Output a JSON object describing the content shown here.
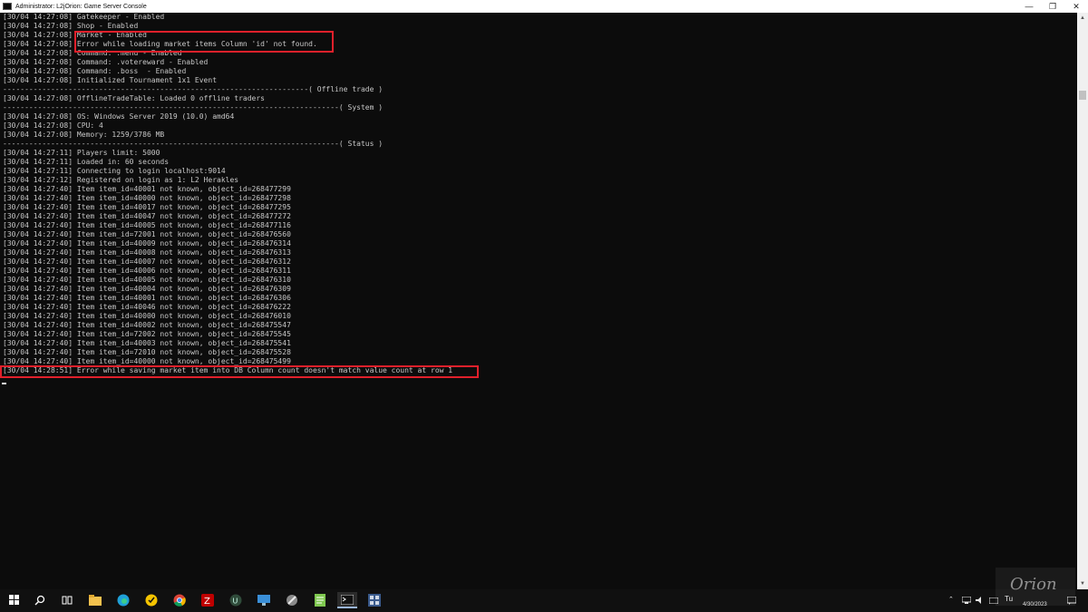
{
  "window": {
    "title": "Administrator: L2jOrion: Game Server Console",
    "minimize": "—",
    "maximize": "❐",
    "close": "✕"
  },
  "console": {
    "lines": [
      "[30/04 14:27:08] Gatekeeper - Enabled",
      "[30/04 14:27:08] Shop - Enabled",
      "[30/04 14:27:08] Market - Enabled",
      "[30/04 14:27:08] Error while loading market items Column 'id' not found.",
      "[30/04 14:27:08] Command: .menu - Enabled",
      "[30/04 14:27:08] Command: .votereward - Enabled",
      "[30/04 14:27:08] Command: .boss  - Enabled",
      "[30/04 14:27:08] Initialized Tournament 1x1 Event",
      "----------------------------------------------------------------------( Offline trade )",
      "[30/04 14:27:08] OfflineTradeTable: Loaded 0 offline traders",
      "-----------------------------------------------------------------------------( System )",
      "[30/04 14:27:08] OS: Windows Server 2019 (10.0) amd64",
      "[30/04 14:27:08] CPU: 4",
      "[30/04 14:27:08] Memory: 1259/3786 MB",
      "-----------------------------------------------------------------------------( Status )",
      "[30/04 14:27:11] Players limit: 5000",
      "[30/04 14:27:11] Loaded in: 60 seconds",
      "[30/04 14:27:11] Connecting to login localhost:9014",
      "[30/04 14:27:12] Registered on login as 1: L2 Herakles",
      "[30/04 14:27:40] Item item_id=40001 not known, object_id=268477299",
      "[30/04 14:27:40] Item item_id=40000 not known, object_id=268477298",
      "[30/04 14:27:40] Item item_id=40017 not known, object_id=268477295",
      "[30/04 14:27:40] Item item_id=40047 not known, object_id=268477272",
      "[30/04 14:27:40] Item item_id=40005 not known, object_id=268477116",
      "[30/04 14:27:40] Item item_id=72001 not known, object_id=268476560",
      "[30/04 14:27:40] Item item_id=40009 not known, object_id=268476314",
      "[30/04 14:27:40] Item item_id=40008 not known, object_id=268476313",
      "[30/04 14:27:40] Item item_id=40007 not known, object_id=268476312",
      "[30/04 14:27:40] Item item_id=40006 not known, object_id=268476311",
      "[30/04 14:27:40] Item item_id=40005 not known, object_id=268476310",
      "[30/04 14:27:40] Item item_id=40004 not known, object_id=268476309",
      "[30/04 14:27:40] Item item_id=40001 not known, object_id=268476306",
      "[30/04 14:27:40] Item item_id=40046 not known, object_id=268476222",
      "[30/04 14:27:40] Item item_id=40000 not known, object_id=268476010",
      "[30/04 14:27:40] Item item_id=40002 not known, object_id=268475547",
      "[30/04 14:27:40] Item item_id=72002 not known, object_id=268475545",
      "[30/04 14:27:40] Item item_id=40003 not known, object_id=268475541",
      "[30/04 14:27:40] Item item_id=72010 not known, object_id=268475528",
      "[30/04 14:27:40] Item item_id=40000 not known, object_id=268475499",
      "[30/04 14:28:51] Error while saving market item into DB Column count doesn't match value count at row 1"
    ]
  },
  "taskbar": {
    "apps": [
      "start-icon",
      "search-icon",
      "task-view-icon",
      "file-explorer-icon",
      "edge-icon",
      "norton-icon",
      "chrome-icon",
      "filezilla-icon",
      "unreal-icon",
      "remote-desktop-icon",
      "tool-icon",
      "notepad-icon",
      "console-icon",
      "app-grid-icon",
      "app-tiles-icon"
    ],
    "tray": {
      "day": "Tu",
      "date": "4/30/2023"
    }
  },
  "watermark": "Orion",
  "colors": {
    "console_bg": "#0c0c0c",
    "console_text": "#c7c7c7",
    "highlight": "#e0202b",
    "taskbar_bg": "#101010"
  }
}
